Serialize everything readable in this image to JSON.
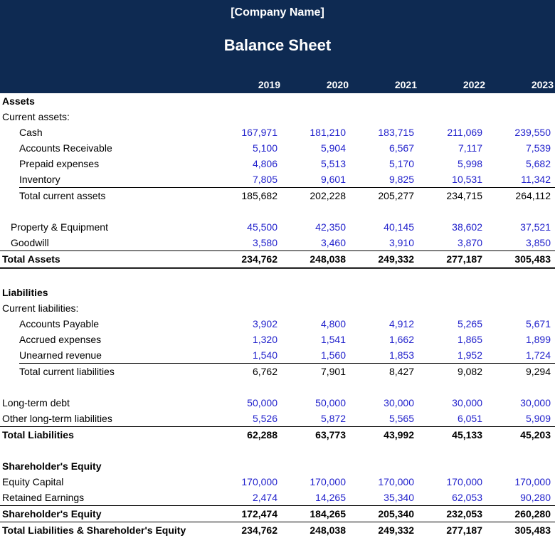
{
  "header": {
    "company": "[Company Name]",
    "title": "Balance Sheet",
    "years": [
      "2019",
      "2020",
      "2021",
      "2022",
      "2023"
    ]
  },
  "colors": {
    "header_bg": "#0e2a52",
    "input_blue": "#2222cc"
  },
  "assets": {
    "heading": "Assets",
    "current_heading": "Current assets:",
    "cash": {
      "label": "Cash",
      "values": [
        "167,971",
        "181,210",
        "183,715",
        "211,069",
        "239,550"
      ]
    },
    "ar": {
      "label": "Accounts Receivable",
      "values": [
        "5,100",
        "5,904",
        "6,567",
        "7,117",
        "7,539"
      ]
    },
    "prepaid": {
      "label": "Prepaid expenses",
      "values": [
        "4,806",
        "5,513",
        "5,170",
        "5,998",
        "5,682"
      ]
    },
    "inventory": {
      "label": "Inventory",
      "values": [
        "7,805",
        "9,601",
        "9,825",
        "10,531",
        "11,342"
      ]
    },
    "total_current": {
      "label": "Total current assets",
      "values": [
        "185,682",
        "202,228",
        "205,277",
        "234,715",
        "264,112"
      ]
    },
    "ppe": {
      "label": "Property & Equipment",
      "values": [
        "45,500",
        "42,350",
        "40,145",
        "38,602",
        "37,521"
      ]
    },
    "goodwill": {
      "label": "Goodwill",
      "values": [
        "3,580",
        "3,460",
        "3,910",
        "3,870",
        "3,850"
      ]
    },
    "total": {
      "label": "Total Assets",
      "values": [
        "234,762",
        "248,038",
        "249,332",
        "277,187",
        "305,483"
      ]
    }
  },
  "liabilities": {
    "heading": "Liabilities",
    "current_heading": "Current liabilities:",
    "ap": {
      "label": "Accounts Payable",
      "values": [
        "3,902",
        "4,800",
        "4,912",
        "5,265",
        "5,671"
      ]
    },
    "accrued": {
      "label": "Accrued expenses",
      "values": [
        "1,320",
        "1,541",
        "1,662",
        "1,865",
        "1,899"
      ]
    },
    "unearned": {
      "label": "Unearned revenue",
      "values": [
        "1,540",
        "1,560",
        "1,853",
        "1,952",
        "1,724"
      ]
    },
    "total_current": {
      "label": "Total current liabilities",
      "values": [
        "6,762",
        "7,901",
        "8,427",
        "9,082",
        "9,294"
      ]
    },
    "ltd": {
      "label": "Long-term debt",
      "values": [
        "50,000",
        "50,000",
        "30,000",
        "30,000",
        "30,000"
      ]
    },
    "other_lt": {
      "label": "Other long-term liabilities",
      "values": [
        "5,526",
        "5,872",
        "5,565",
        "6,051",
        "5,909"
      ]
    },
    "total": {
      "label": "Total Liabilities",
      "values": [
        "62,288",
        "63,773",
        "43,992",
        "45,133",
        "45,203"
      ]
    }
  },
  "equity": {
    "heading": "Shareholder's Equity",
    "capital": {
      "label": "Equity Capital",
      "values": [
        "170,000",
        "170,000",
        "170,000",
        "170,000",
        "170,000"
      ]
    },
    "retained": {
      "label": "Retained Earnings",
      "values": [
        "2,474",
        "14,265",
        "35,340",
        "62,053",
        "90,280"
      ]
    },
    "total": {
      "label": "Shareholder's Equity",
      "values": [
        "172,474",
        "184,265",
        "205,340",
        "232,053",
        "260,280"
      ]
    },
    "grand_total": {
      "label": "Total Liabilities & Shareholder's Equity",
      "values": [
        "234,762",
        "248,038",
        "249,332",
        "277,187",
        "305,483"
      ]
    }
  }
}
